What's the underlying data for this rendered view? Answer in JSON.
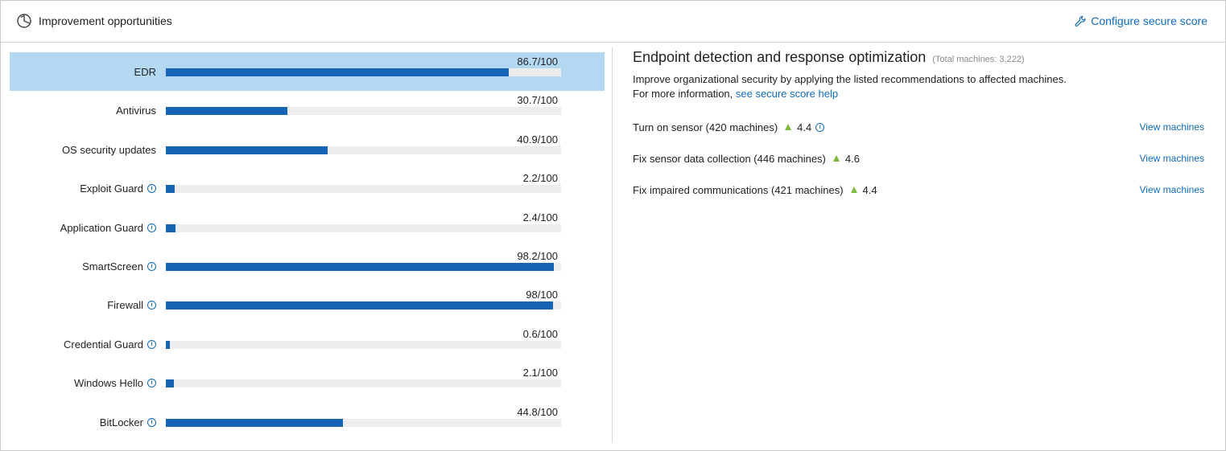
{
  "header": {
    "title": "Improvement opportunities",
    "configure_label": "Configure secure score"
  },
  "scores": [
    {
      "label": "EDR",
      "score_text": "86.7/100",
      "value": 86.7,
      "info": false,
      "selected": true
    },
    {
      "label": "Antivirus",
      "score_text": "30.7/100",
      "value": 30.7,
      "info": false,
      "selected": false
    },
    {
      "label": "OS security updates",
      "score_text": "40.9/100",
      "value": 40.9,
      "info": false,
      "selected": false
    },
    {
      "label": "Exploit Guard",
      "score_text": "2.2/100",
      "value": 2.2,
      "info": true,
      "selected": false
    },
    {
      "label": "Application Guard",
      "score_text": "2.4/100",
      "value": 2.4,
      "info": true,
      "selected": false
    },
    {
      "label": "SmartScreen",
      "score_text": "98.2/100",
      "value": 98.2,
      "info": true,
      "selected": false
    },
    {
      "label": "Firewall",
      "score_text": "98/100",
      "value": 98,
      "info": true,
      "selected": false
    },
    {
      "label": "Credential Guard",
      "score_text": "0.6/100",
      "value": 0.6,
      "info": true,
      "selected": false
    },
    {
      "label": "Windows Hello",
      "score_text": "2.1/100",
      "value": 2.1,
      "info": true,
      "selected": false
    },
    {
      "label": "BitLocker",
      "score_text": "44.8/100",
      "value": 44.8,
      "info": true,
      "selected": false
    }
  ],
  "detail": {
    "title": "Endpoint detection and response optimization",
    "total": "(Total machines: 3,222)",
    "description_line1": "Improve organizational security by applying the listed recommendations to affected machines.",
    "description_line2_prefix": "For more information, ",
    "help_link": "see secure score help",
    "recommendations": [
      {
        "text": "Turn on sensor (420 machines)",
        "score": "4.4",
        "info": true,
        "action": "View machines"
      },
      {
        "text": "Fix sensor data collection (446 machines)",
        "score": "4.6",
        "info": false,
        "action": "View machines"
      },
      {
        "text": "Fix impaired communications (421 machines)",
        "score": "4.4",
        "info": false,
        "action": "View machines"
      }
    ]
  },
  "colors": {
    "accent": "#0f6cbd",
    "bar": "#1664b4",
    "selected_row": "#b4d7f2",
    "increase": "#7cbb3a"
  }
}
